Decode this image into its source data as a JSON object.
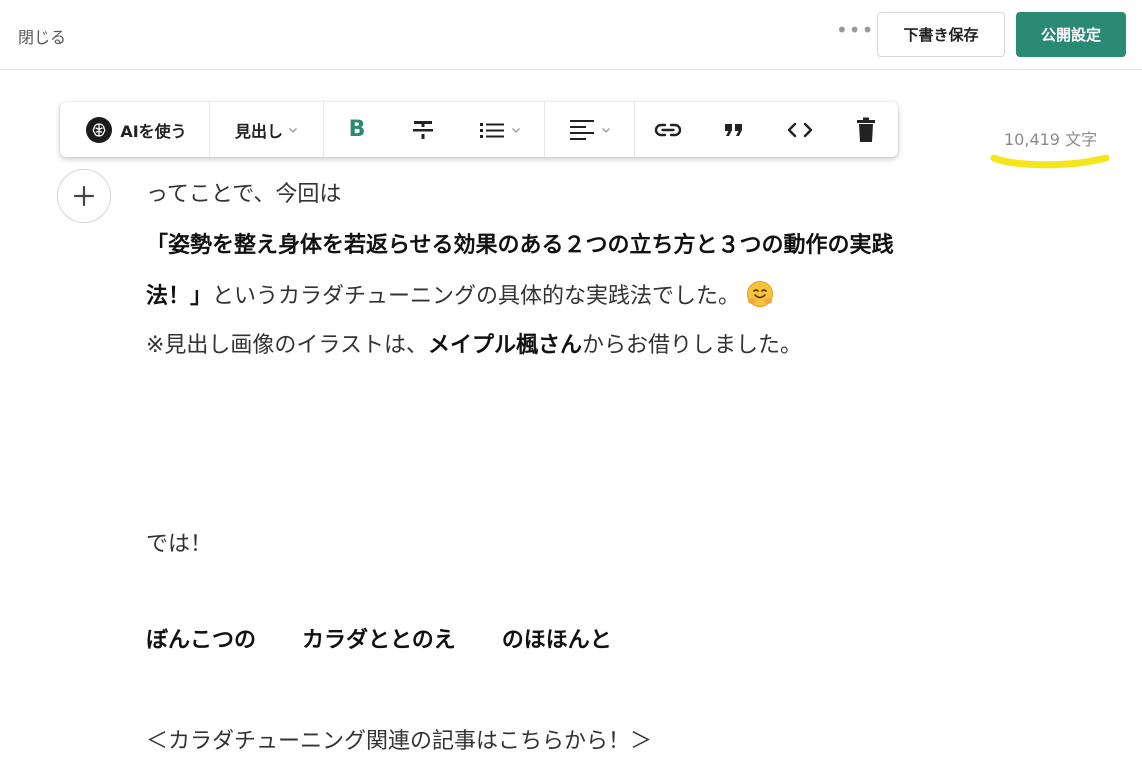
{
  "header": {
    "close_label": "閉じる",
    "more_icon": "more-dots-icon",
    "draft_label": "下書き保存",
    "publish_label": "公開設定"
  },
  "toolbar": {
    "ai_label": "AIを使う",
    "heading_label": "見出し",
    "bold_glyph": "B",
    "icons": [
      "brain-icon",
      "bold-icon",
      "strikethrough-icon",
      "list-icon",
      "align-left-icon",
      "link-icon",
      "quote-icon",
      "code-icon",
      "trash-icon"
    ]
  },
  "status": {
    "char_count": "10,419 文字"
  },
  "colors": {
    "accent": "#2b8a73",
    "highlight": "#f5e51b"
  },
  "content": {
    "line1": "ってことで、今回は",
    "line2": "「姿勢を整え身体を若返らせる効果のある２つの立ち方と３つの動作の実践",
    "line3_bold": "法！」",
    "line3_rest": "というカラダチューニングの具体的な実践法でした。",
    "line4_prefix": "※見出し画像のイラストは、",
    "line4_bold": "メイプル楓さん",
    "line4_suffix": "からお借りしました。",
    "line5": "では！",
    "signature": [
      "ぼんこつの",
      "カラダととのえ",
      "のほほんと"
    ],
    "line7": "＜カラダチューニング関連の記事はこちらから！＞"
  }
}
